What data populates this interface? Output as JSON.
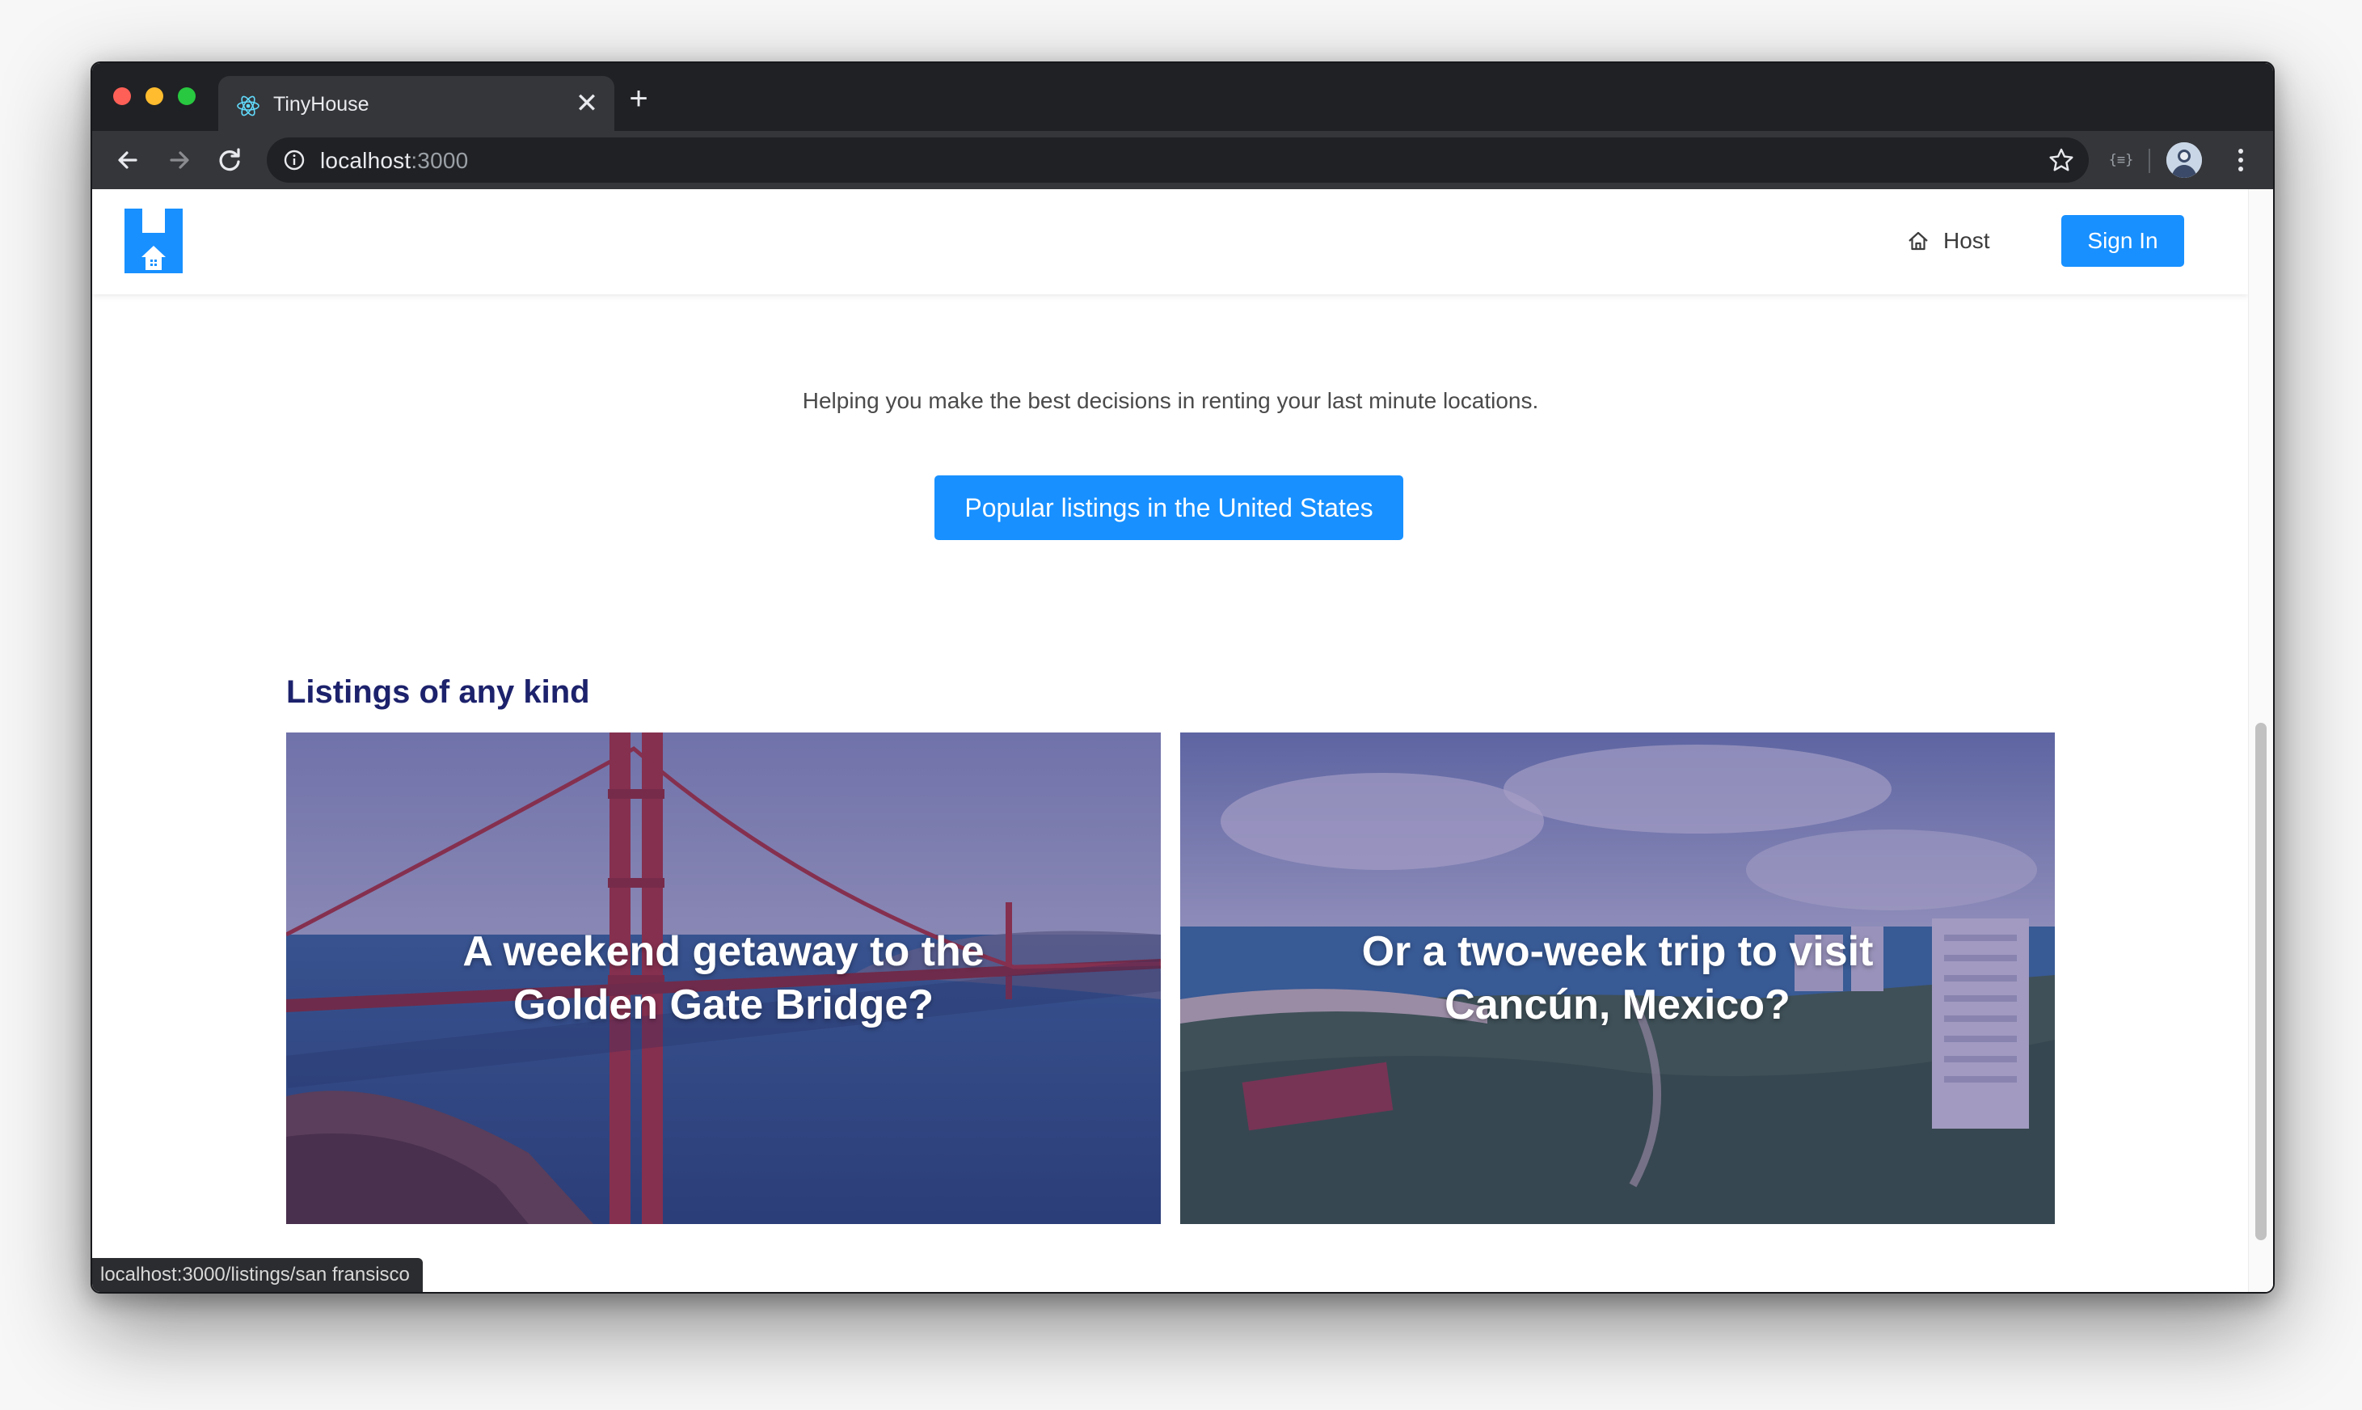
{
  "browser": {
    "tab_title": "TinyHouse",
    "new_tab_label": "+",
    "close_tab_label": "✕",
    "url_host": "localhost",
    "url_port": ":3000",
    "extension_label": "{≡}"
  },
  "header": {
    "host_label": "Host",
    "signin_label": "Sign In"
  },
  "hero": {
    "subtitle": "Helping you make the best decisions in renting your last minute locations.",
    "popular_button": "Popular listings in the United States"
  },
  "listings": {
    "title": "Listings of any kind",
    "cards": [
      {
        "line1": "A weekend getaway to the",
        "line2": "Golden Gate Bridge?"
      },
      {
        "line1": "Or a two-week trip to visit",
        "line2": "Cancún, Mexico?"
      }
    ]
  },
  "status_bar": {
    "url": "localhost:3000/listings/san fransisco"
  },
  "colors": {
    "primary": "#1890ff",
    "section_title": "#1d226c",
    "overlay": "#442e82"
  }
}
